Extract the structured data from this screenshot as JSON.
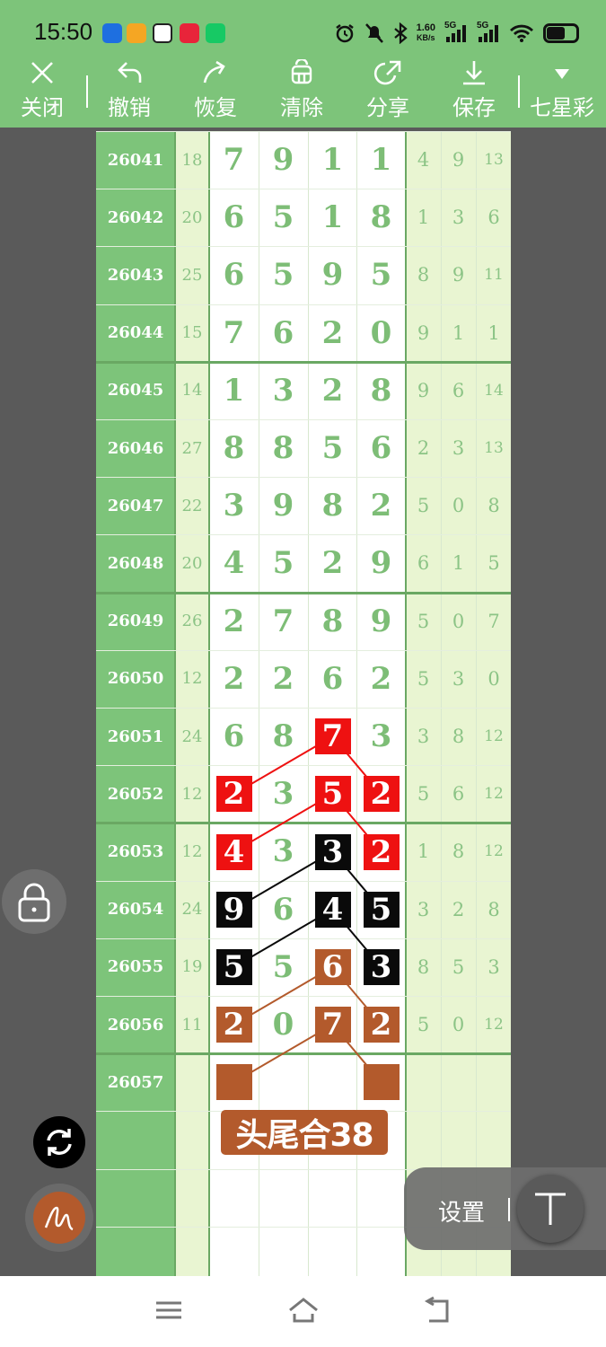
{
  "status": {
    "time": "15:50",
    "net_speed_value": "1.60",
    "net_speed_unit": "KB/s",
    "sig1": "5G",
    "sig2": "5G"
  },
  "toolbar": {
    "close": "关闭",
    "undo": "撤销",
    "redo": "恢复",
    "clear": "清除",
    "share": "分享",
    "save": "保存",
    "lottery": "七星彩"
  },
  "rows": [
    {
      "issue": "26041",
      "sum": "18",
      "digits": [
        "7",
        "9",
        "1",
        "1"
      ],
      "tails": [
        "4",
        "9",
        "13"
      ]
    },
    {
      "issue": "26042",
      "sum": "20",
      "digits": [
        "6",
        "5",
        "1",
        "8"
      ],
      "tails": [
        "1",
        "3",
        "6"
      ]
    },
    {
      "issue": "26043",
      "sum": "25",
      "digits": [
        "6",
        "5",
        "9",
        "5"
      ],
      "tails": [
        "8",
        "9",
        "11"
      ]
    },
    {
      "issue": "26044",
      "sum": "15",
      "digits": [
        "7",
        "6",
        "2",
        "0"
      ],
      "tails": [
        "9",
        "1",
        "1"
      ]
    },
    {
      "issue": "26045",
      "sum": "14",
      "digits": [
        "1",
        "3",
        "2",
        "8"
      ],
      "tails": [
        "9",
        "6",
        "14"
      ]
    },
    {
      "issue": "26046",
      "sum": "27",
      "digits": [
        "8",
        "8",
        "5",
        "6"
      ],
      "tails": [
        "2",
        "3",
        "13"
      ]
    },
    {
      "issue": "26047",
      "sum": "22",
      "digits": [
        "3",
        "9",
        "8",
        "2"
      ],
      "tails": [
        "5",
        "0",
        "8"
      ]
    },
    {
      "issue": "26048",
      "sum": "20",
      "digits": [
        "4",
        "5",
        "2",
        "9"
      ],
      "tails": [
        "6",
        "1",
        "5"
      ]
    },
    {
      "issue": "26049",
      "sum": "26",
      "digits": [
        "2",
        "7",
        "8",
        "9"
      ],
      "tails": [
        "5",
        "0",
        "7"
      ]
    },
    {
      "issue": "26050",
      "sum": "12",
      "digits": [
        "2",
        "2",
        "6",
        "2"
      ],
      "tails": [
        "5",
        "3",
        "0"
      ]
    },
    {
      "issue": "26051",
      "sum": "24",
      "digits": [
        "6",
        "8",
        "7",
        "3"
      ],
      "tails": [
        "3",
        "8",
        "12"
      ]
    },
    {
      "issue": "26052",
      "sum": "12",
      "digits": [
        "2",
        "3",
        "5",
        "2"
      ],
      "tails": [
        "5",
        "6",
        "12"
      ]
    },
    {
      "issue": "26053",
      "sum": "12",
      "digits": [
        "4",
        "3",
        "3",
        "2"
      ],
      "tails": [
        "1",
        "8",
        "12"
      ]
    },
    {
      "issue": "26054",
      "sum": "24",
      "digits": [
        "9",
        "6",
        "4",
        "5"
      ],
      "tails": [
        "3",
        "2",
        "8"
      ]
    },
    {
      "issue": "26055",
      "sum": "19",
      "digits": [
        "5",
        "5",
        "6",
        "3"
      ],
      "tails": [
        "8",
        "5",
        "3"
      ]
    },
    {
      "issue": "26056",
      "sum": "11",
      "digits": [
        "2",
        "0",
        "7",
        "2"
      ],
      "tails": [
        "5",
        "0",
        "12"
      ]
    },
    {
      "issue": "26057",
      "sum": "",
      "digits": [
        "",
        "",
        "",
        ""
      ],
      "tails": [
        "",
        "",
        ""
      ]
    }
  ],
  "highlights": [
    {
      "row": 10,
      "col": 2,
      "color": "red"
    },
    {
      "row": 11,
      "col": 0,
      "color": "red"
    },
    {
      "row": 11,
      "col": 2,
      "color": "red"
    },
    {
      "row": 11,
      "col": 3,
      "color": "red"
    },
    {
      "row": 12,
      "col": 0,
      "color": "red"
    },
    {
      "row": 12,
      "col": 2,
      "color": "black"
    },
    {
      "row": 12,
      "col": 3,
      "color": "red"
    },
    {
      "row": 13,
      "col": 0,
      "color": "black"
    },
    {
      "row": 13,
      "col": 2,
      "color": "black"
    },
    {
      "row": 13,
      "col": 3,
      "color": "black"
    },
    {
      "row": 14,
      "col": 0,
      "color": "black"
    },
    {
      "row": 14,
      "col": 2,
      "color": "brown"
    },
    {
      "row": 14,
      "col": 3,
      "color": "black"
    },
    {
      "row": 15,
      "col": 0,
      "color": "brown"
    },
    {
      "row": 15,
      "col": 2,
      "color": "brown"
    },
    {
      "row": 15,
      "col": 3,
      "color": "brown"
    },
    {
      "row": 16,
      "col": 0,
      "color": "brown"
    },
    {
      "row": 16,
      "col": 3,
      "color": "brown"
    }
  ],
  "connections": [
    {
      "from": [
        10,
        2
      ],
      "to": [
        11,
        0
      ],
      "color": "red"
    },
    {
      "from": [
        10,
        2
      ],
      "to": [
        11,
        3
      ],
      "color": "red"
    },
    {
      "from": [
        11,
        2
      ],
      "to": [
        12,
        0
      ],
      "color": "red"
    },
    {
      "from": [
        11,
        2
      ],
      "to": [
        12,
        3
      ],
      "color": "red"
    },
    {
      "from": [
        12,
        2
      ],
      "to": [
        13,
        0
      ],
      "color": "black"
    },
    {
      "from": [
        12,
        2
      ],
      "to": [
        13,
        3
      ],
      "color": "black"
    },
    {
      "from": [
        13,
        2
      ],
      "to": [
        14,
        0
      ],
      "color": "black"
    },
    {
      "from": [
        13,
        2
      ],
      "to": [
        14,
        3
      ],
      "color": "black"
    },
    {
      "from": [
        14,
        2
      ],
      "to": [
        15,
        0
      ],
      "color": "brown"
    },
    {
      "from": [
        14,
        2
      ],
      "to": [
        15,
        3
      ],
      "color": "brown"
    },
    {
      "from": [
        15,
        2
      ],
      "to": [
        16,
        0
      ],
      "color": "brown"
    },
    {
      "from": [
        15,
        2
      ],
      "to": [
        16,
        3
      ],
      "color": "brown"
    }
  ],
  "colors": {
    "red": "#ee1111",
    "black": "#0a0a0a",
    "brown": "#b35a2c"
  },
  "annotation": "头尾合38",
  "settings_label": "设置"
}
